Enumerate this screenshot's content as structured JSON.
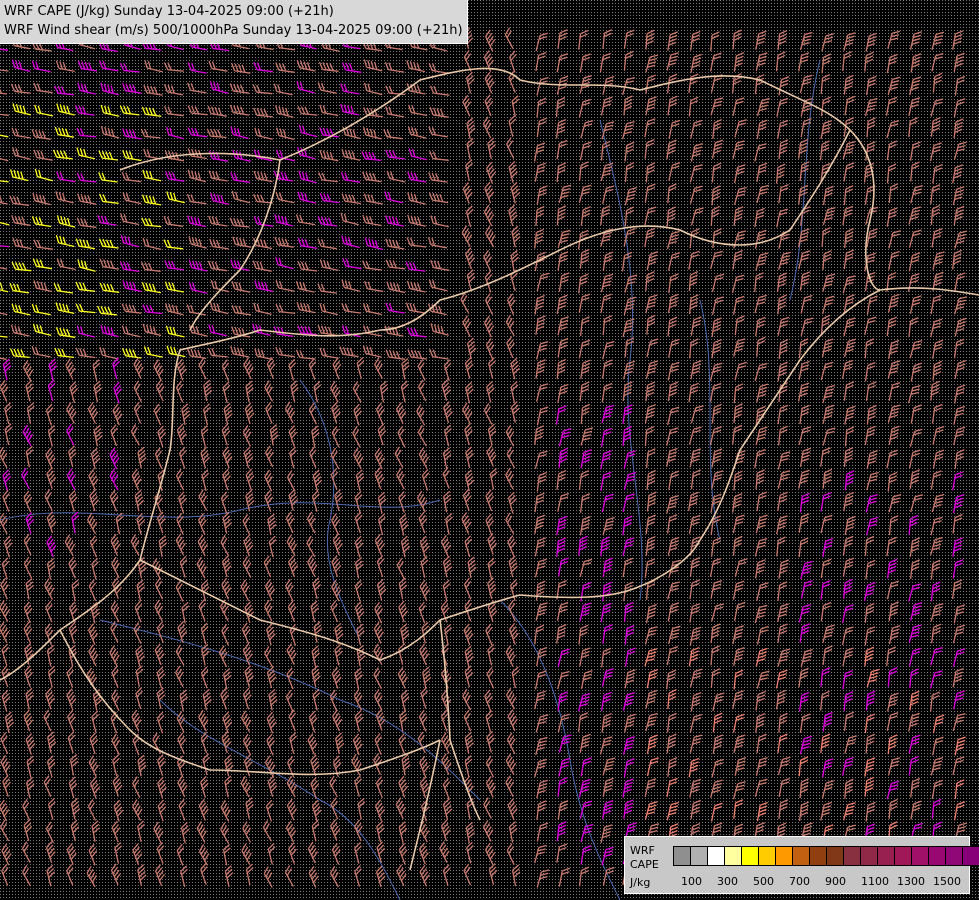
{
  "title": {
    "line1": "WRF CAPE (J/kg) Sunday 13-04-2025 09:00 (+21h)",
    "line2": "WRF Wind shear (m/s) 500/1000hPa Sunday 13-04-2025 09:00 (+21h)"
  },
  "legend": {
    "line1": "WRF",
    "line2": "CAPE",
    "line3": "J/kg",
    "swatches": [
      "#8f8f8f",
      "#b0b0b0",
      "#ffffff",
      "#ffffa0",
      "#ffff00",
      "#ffcc00",
      "#ff9900",
      "#c06010",
      "#904010",
      "#803818",
      "#883040",
      "#902848",
      "#982050",
      "#a01858",
      "#a01068",
      "#980870",
      "#900878",
      "#880078",
      "#800078",
      "#a000a0"
    ],
    "ticks": [
      "100",
      "300",
      "500",
      "700",
      "900",
      "1100",
      "1300",
      "1500"
    ]
  },
  "colors": {
    "background": "#000000",
    "barb_default": "#c87a6e",
    "barb_magenta": "#e000e0",
    "barb_yellow": "#ffff20",
    "barb_salmon": "#f08070",
    "border": "#e8c8a8",
    "river": "#5070c0",
    "stipple": "#808080"
  }
}
